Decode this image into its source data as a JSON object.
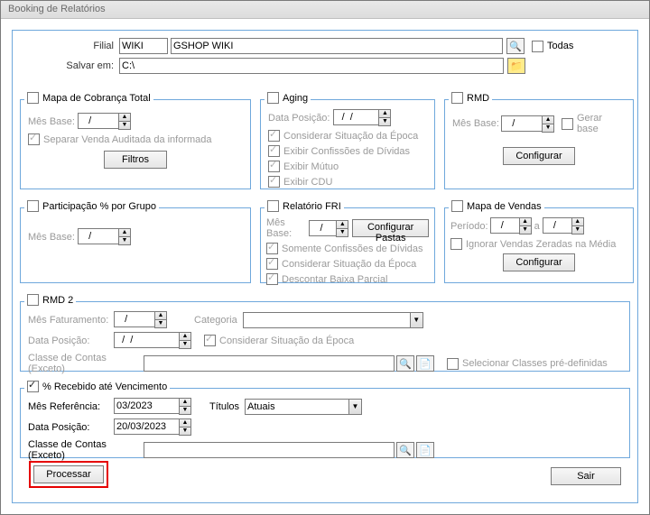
{
  "window": {
    "title": "Booking de Relatórios"
  },
  "top": {
    "filial_label": "Filial",
    "filial_code": "WIKI",
    "filial_name": "GSHOP WIKI",
    "todas_label": "Todas",
    "salvar_label": "Salvar em:",
    "salvar_value": "C:\\"
  },
  "cobranca": {
    "title": "Mapa de Cobrança Total",
    "mesbase_label": "Mês Base:",
    "mesbase_value": "   /",
    "separar_label": "Separar Venda Auditada da informada",
    "filtros_btn": "Filtros"
  },
  "aging": {
    "title": "Aging",
    "datapos_label": "Data Posição:",
    "datapos_value": "  /  /",
    "c1": "Considerar Situação da Época",
    "c2": "Exibir Confissões de Dívidas",
    "c3": "Exibir Mútuo",
    "c4": "Exibir CDU"
  },
  "rmd": {
    "title": "RMD",
    "mesbase_label": "Mês Base:",
    "mesbase_value": "   /",
    "gerar_label": "Gerar base",
    "config_btn": "Configurar"
  },
  "participacao": {
    "title": "Participação % por Grupo",
    "mesbase_label": "Mês Base:",
    "mesbase_value": "   /"
  },
  "fri": {
    "title": "Relatório FRI",
    "mesbase_label": "Mês Base:",
    "mesbase_value": "   /",
    "config_btn": "Configurar Pastas",
    "c1": "Somente Confissões de Dívidas",
    "c2": "Considerar Situação da Época",
    "c3": "Descontar Baixa Parcial"
  },
  "vendas": {
    "title": "Mapa de Vendas",
    "periodo_label": "Período:",
    "periodo_a": "a",
    "periodo_v1": "   /",
    "periodo_v2": "   /",
    "ignorar_label": "Ignorar Vendas Zeradas na Média",
    "config_btn": "Configurar"
  },
  "rmd2": {
    "title": "RMD 2",
    "mesfat_label": "Mês Faturamento:",
    "mesfat_value": "   /",
    "categoria_label": "Categoria",
    "datapos_label": "Data Posição:",
    "datapos_value": "  /  /",
    "considerar_label": "Considerar Situação da Época",
    "classe_label": "Classe de Contas (Exceto)",
    "selecionar_label": "Selecionar Classes pré-definidas"
  },
  "recebido": {
    "title": "% Recebido até Vencimento",
    "mesref_label": "Mês Referência:",
    "mesref_value": "03/2023",
    "titulos_label": "Títulos",
    "titulos_value": "Atuais",
    "datapos_label": "Data Posição:",
    "datapos_value": "20/03/2023",
    "classe_label": "Classe de Contas (Exceto)"
  },
  "footer": {
    "processar": "Processar",
    "sair": "Sair"
  }
}
